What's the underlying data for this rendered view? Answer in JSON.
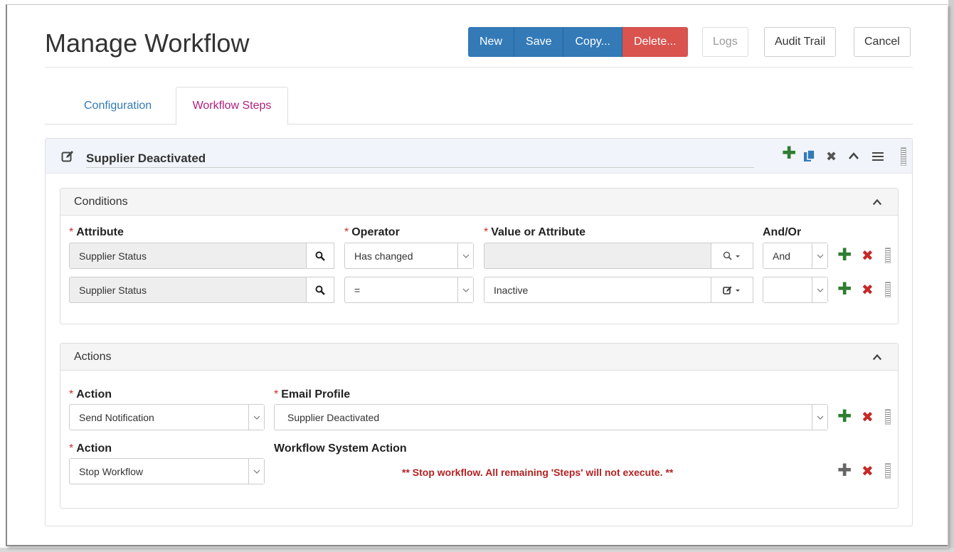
{
  "page": {
    "title": "Manage Workflow"
  },
  "toolbar": {
    "new_label": "New",
    "save_label": "Save",
    "copy_label": "Copy...",
    "delete_label": "Delete...",
    "logs_label": "Logs",
    "audit_label": "Audit Trail",
    "cancel_label": "Cancel"
  },
  "tabs": [
    {
      "label": "Configuration",
      "active": false
    },
    {
      "label": "Workflow Steps",
      "active": true
    }
  ],
  "step": {
    "title": "Supplier Deactivated"
  },
  "conditions": {
    "title": "Conditions",
    "headers": {
      "attribute": "Attribute",
      "operator": "Operator",
      "value": "Value or Attribute",
      "andor": "And/Or"
    },
    "rows": [
      {
        "attribute": "Supplier Status",
        "operator": "Has changed",
        "value": "",
        "andor": "And"
      },
      {
        "attribute": "Supplier Status",
        "operator": "=",
        "value": "Inactive",
        "andor": ""
      }
    ]
  },
  "actions": {
    "title": "Actions",
    "rows": [
      {
        "action_label": "Action",
        "action": "Send Notification",
        "param_label": "Email Profile",
        "param": "Supplier Deactivated"
      },
      {
        "action_label": "Action",
        "action": "Stop Workflow",
        "param_label": "Workflow System Action",
        "message": "** Stop workflow. All remaining 'Steps' will not execute. **"
      }
    ]
  },
  "colors": {
    "primary": "#337ab7",
    "danger": "#d9534f",
    "tab_active": "#b0207e",
    "add_green": "#2e7d32",
    "remove_red": "#c62828"
  }
}
